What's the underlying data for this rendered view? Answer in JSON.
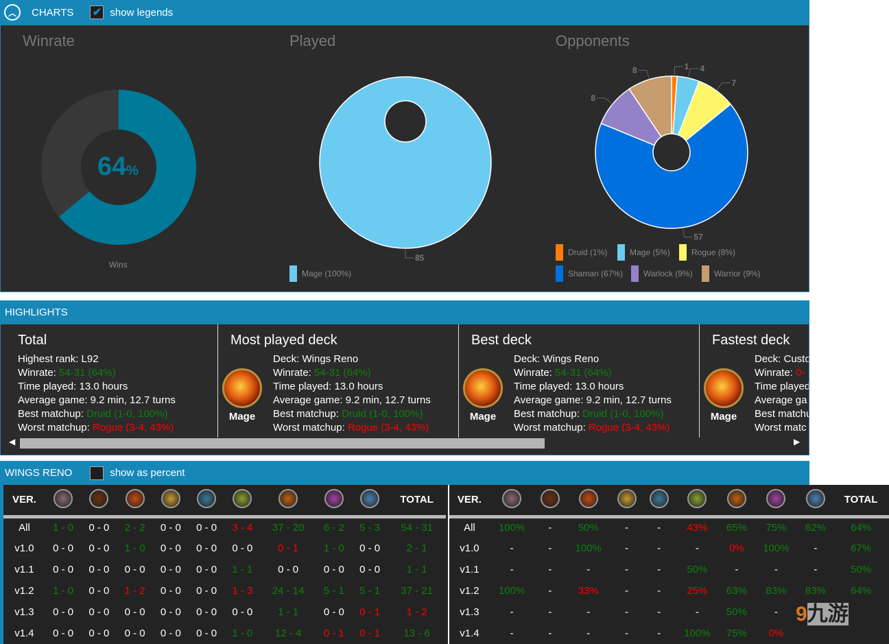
{
  "charts_header": {
    "title": "CHARTS",
    "show_legends_label": "show legends",
    "show_legends_checked": true
  },
  "charts": {
    "winrate": {
      "title": "Winrate",
      "center_value": "64",
      "center_unit": "%",
      "legend": "Wins"
    },
    "played": {
      "title": "Played",
      "legend": "Mage (100%)"
    },
    "opponents": {
      "title": "Opponents"
    }
  },
  "chart_data": [
    {
      "type": "pie",
      "title": "Winrate",
      "categories": [
        "Wins",
        "Losses"
      ],
      "values": [
        64,
        36
      ],
      "colors": [
        "#007a99",
        "#383838"
      ],
      "legend": [
        "Wins"
      ],
      "legend_placement": "bottom"
    },
    {
      "type": "pie",
      "title": "Played",
      "categories": [
        "Mage"
      ],
      "values": [
        85
      ],
      "data_labels": [
        "85"
      ],
      "colors": [
        "#6ccbf0"
      ],
      "legend": [
        "Mage (100%)"
      ],
      "legend_placement": "bottom"
    },
    {
      "type": "pie",
      "title": "Opponents",
      "categories": [
        "Druid",
        "Mage",
        "Rogue",
        "Shaman",
        "Warlock",
        "Warrior"
      ],
      "values": [
        1,
        4,
        7,
        57,
        8,
        8
      ],
      "data_labels": [
        "1",
        "4",
        "7",
        "57",
        "8",
        "8"
      ],
      "colors": [
        "#ff7d0a",
        "#69ccf0",
        "#fff569",
        "#0070de",
        "#9482c9",
        "#c79c6e"
      ],
      "legend": [
        "Druid (1%)",
        "Mage (5%)",
        "Rogue (8%)",
        "Shaman (67%)",
        "Warlock (9%)",
        "Warrior (9%)"
      ],
      "legend_placement": "bottom"
    }
  ],
  "highlights": {
    "title": "HIGHLIGHTS",
    "total": {
      "title": "Total",
      "rank_label": "Highest rank: ",
      "rank": "L92",
      "winrate_label": "Winrate: ",
      "winrate": "54-31 (64%)",
      "time": "Time played: 13.0 hours",
      "avg": "Average game: 9.2 min, 12.7 turns",
      "best_label": "Best matchup: ",
      "best": "Druid (1-0, 100%)",
      "worst_label": "Worst matchup: ",
      "worst": "Rogue (3-4, 43%)"
    },
    "most_played": {
      "title": "Most played deck",
      "class": "Mage",
      "deck": "Deck: Wings Reno",
      "winrate_label": "Winrate: ",
      "winrate": "54-31 (64%)",
      "time": "Time played: 13.0 hours",
      "avg": "Average game: 9.2 min, 12.7 turns",
      "best_label": "Best matchup: ",
      "best": "Druid (1-0, 100%)",
      "worst_label": "Worst matchup: ",
      "worst": "Rogue (3-4, 43%)"
    },
    "best": {
      "title": "Best deck",
      "class": "Mage",
      "deck": "Deck: Wings Reno",
      "winrate_label": "Winrate: ",
      "winrate": "54-31 (64%)",
      "time": "Time played: 13.0 hours",
      "avg": "Average game: 9.2 min, 12.7 turns",
      "best_label": "Best matchup: ",
      "best": "Druid (1-0, 100%)",
      "worst_label": "Worst matchup: ",
      "worst": "Rogue (3-4, 43%)"
    },
    "fastest": {
      "title": "Fastest deck",
      "class": "Mage",
      "deck": "Deck: Custo",
      "winrate_label": "Winrate: ",
      "winrate": "0-",
      "time": "Time played",
      "avg": "Average ga",
      "best_label": "Best matchu",
      "worst_label": "Worst matc"
    },
    "scroll_fraction": 0.6
  },
  "deck": {
    "title": "WINGS RENO",
    "show_percent_label": "show as percent",
    "show_percent_checked": false,
    "ver_header": "VER.",
    "total_header": "TOTAL",
    "class_icons": [
      "druid-icon",
      "hunter-icon",
      "mage-icon",
      "paladin-icon",
      "priest-icon",
      "rogue-icon",
      "shaman-icon",
      "warlock-icon",
      "warrior-icon"
    ],
    "icon_colors": [
      "#8a6a70",
      "#6a3010",
      "#c84a10",
      "#c89a30",
      "#3a7a9a",
      "#8aa030",
      "#c06010",
      "#a040a0",
      "#4a80b0"
    ],
    "records": [
      {
        "ver": "All",
        "cells": [
          "1 - 0",
          "0 - 0",
          "2 - 2",
          "0 - 0",
          "0 - 0",
          "3 - 4",
          "37 - 20",
          "6 - 2",
          "5 - 3",
          "54 - 31"
        ],
        "colors": [
          "g",
          "w",
          "g",
          "w",
          "w",
          "r",
          "g",
          "g",
          "g",
          "g"
        ]
      },
      {
        "ver": "v1.0",
        "cells": [
          "0 - 0",
          "0 - 0",
          "1 - 0",
          "0 - 0",
          "0 - 0",
          "0 - 0",
          "0 - 1",
          "1 - 0",
          "0 - 0",
          "2 - 1"
        ],
        "colors": [
          "w",
          "w",
          "g",
          "w",
          "w",
          "w",
          "r",
          "g",
          "w",
          "g"
        ]
      },
      {
        "ver": "v1.1",
        "cells": [
          "0 - 0",
          "0 - 0",
          "0 - 0",
          "0 - 0",
          "0 - 0",
          "1 - 1",
          "0 - 0",
          "0 - 0",
          "0 - 0",
          "1 - 1"
        ],
        "colors": [
          "w",
          "w",
          "w",
          "w",
          "w",
          "g",
          "w",
          "w",
          "w",
          "g"
        ]
      },
      {
        "ver": "v1.2",
        "cells": [
          "1 - 0",
          "0 - 0",
          "1 - 2",
          "0 - 0",
          "0 - 0",
          "1 - 3",
          "24 - 14",
          "5 - 1",
          "5 - 1",
          "37 - 21"
        ],
        "colors": [
          "g",
          "w",
          "r",
          "w",
          "w",
          "r",
          "g",
          "g",
          "g",
          "g"
        ]
      },
      {
        "ver": "v1.3",
        "cells": [
          "0 - 0",
          "0 - 0",
          "0 - 0",
          "0 - 0",
          "0 - 0",
          "0 - 0",
          "1 - 1",
          "0 - 0",
          "0 - 1",
          "1 - 2"
        ],
        "colors": [
          "w",
          "w",
          "w",
          "w",
          "w",
          "w",
          "g",
          "w",
          "r",
          "r"
        ]
      },
      {
        "ver": "v1.4",
        "cells": [
          "0 - 0",
          "0 - 0",
          "0 - 0",
          "0 - 0",
          "0 - 0",
          "1 - 0",
          "12 - 4",
          "0 - 1",
          "0 - 1",
          "13 - 6"
        ],
        "colors": [
          "w",
          "w",
          "w",
          "w",
          "w",
          "g",
          "g",
          "r",
          "r",
          "g"
        ]
      }
    ],
    "percents": [
      {
        "ver": "All",
        "cells": [
          "100%",
          "-",
          "50%",
          "-",
          "-",
          "43%",
          "65%",
          "75%",
          "62%",
          "64%"
        ],
        "colors": [
          "g",
          "w",
          "g",
          "w",
          "w",
          "r",
          "g",
          "g",
          "g",
          "g"
        ]
      },
      {
        "ver": "v1.0",
        "cells": [
          "-",
          "-",
          "100%",
          "-",
          "-",
          "-",
          "0%",
          "100%",
          "-",
          "67%"
        ],
        "colors": [
          "w",
          "w",
          "g",
          "w",
          "w",
          "w",
          "r",
          "g",
          "w",
          "g"
        ]
      },
      {
        "ver": "v1.1",
        "cells": [
          "-",
          "-",
          "-",
          "-",
          "-",
          "50%",
          "-",
          "-",
          "-",
          "50%"
        ],
        "colors": [
          "w",
          "w",
          "w",
          "w",
          "w",
          "g",
          "w",
          "w",
          "w",
          "g"
        ]
      },
      {
        "ver": "v1.2",
        "cells": [
          "100%",
          "-",
          "33%",
          "-",
          "-",
          "25%",
          "63%",
          "83%",
          "83%",
          "64%"
        ],
        "colors": [
          "g",
          "w",
          "r",
          "w",
          "w",
          "r",
          "g",
          "g",
          "g",
          "g"
        ]
      },
      {
        "ver": "v1.3",
        "cells": [
          "-",
          "-",
          "-",
          "-",
          "-",
          "-",
          "50%",
          "-",
          "",
          ""
        ],
        "colors": [
          "w",
          "w",
          "w",
          "w",
          "w",
          "w",
          "g",
          "w",
          "w",
          "w"
        ]
      },
      {
        "ver": "v1.4",
        "cells": [
          "-",
          "-",
          "-",
          "-",
          "-",
          "100%",
          "75%",
          "0%",
          "",
          ""
        ],
        "colors": [
          "w",
          "w",
          "w",
          "w",
          "w",
          "g",
          "g",
          "r",
          "w",
          "w"
        ]
      }
    ]
  },
  "watermark": {
    "text": "九游"
  }
}
